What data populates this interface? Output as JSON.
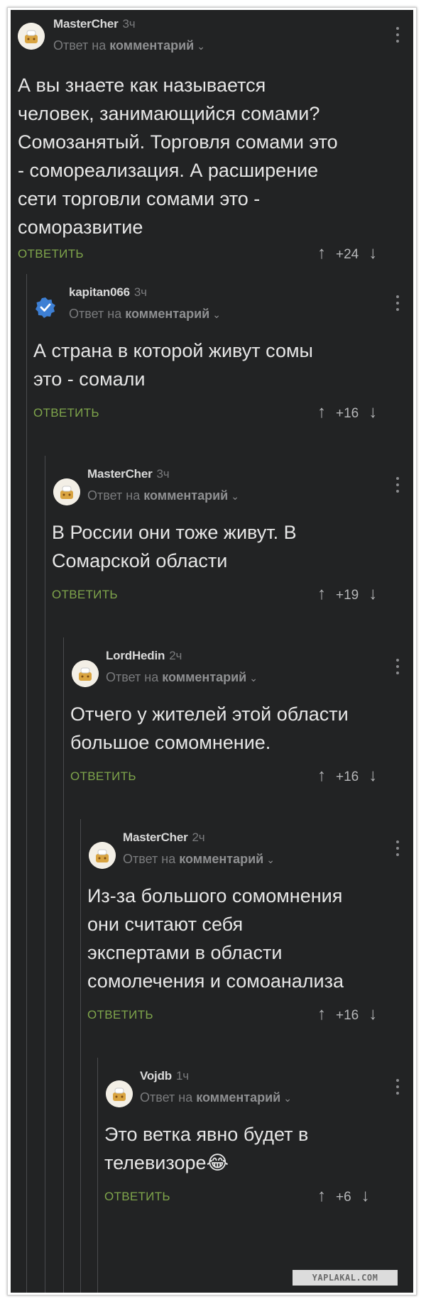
{
  "reply_to_prefix": "Ответ на",
  "reply_to_target": "комментарий",
  "reply_label": "ОТВЕТИТЬ",
  "comments": [
    {
      "author": "MasterCher",
      "time": "3ч",
      "text": "А вы знаете как называется\nчеловек, занимающийся сомами?\nСомозанятый. Торговля сомами это\n- сомореализация. А расширение\nсети торговли сомами это -\nсоморазвитие",
      "score": "+24",
      "avatar": "chef-avatar"
    },
    {
      "author": "kapitan066",
      "time": "3ч",
      "text": "А страна в которой живут сомы\nэто - сомали",
      "score": "+16",
      "avatar": "verified-badge"
    },
    {
      "author": "MasterCher",
      "time": "3ч",
      "text": "В России они тоже живут. В\nСомарской области",
      "score": "+19",
      "avatar": "chef-avatar"
    },
    {
      "author": "LordHedin",
      "time": "2ч",
      "text": "Отчего у жителей этой области\nбольшое сомомнение.",
      "score": "+16",
      "avatar": "chef-avatar"
    },
    {
      "author": "MasterCher",
      "time": "2ч",
      "text": "Из-за большого сомомнения\nони считают себя\nэкспертами в области\nсомолечения и сомоанализа",
      "score": "+16",
      "avatar": "chef-avatar"
    },
    {
      "author": "Vojdb",
      "time": "1ч",
      "text": "Это ветка явно будет в\nтелевизоре😂",
      "score": "+6",
      "avatar": "chef-avatar"
    }
  ],
  "watermark": "YAPLAKAL.COM"
}
